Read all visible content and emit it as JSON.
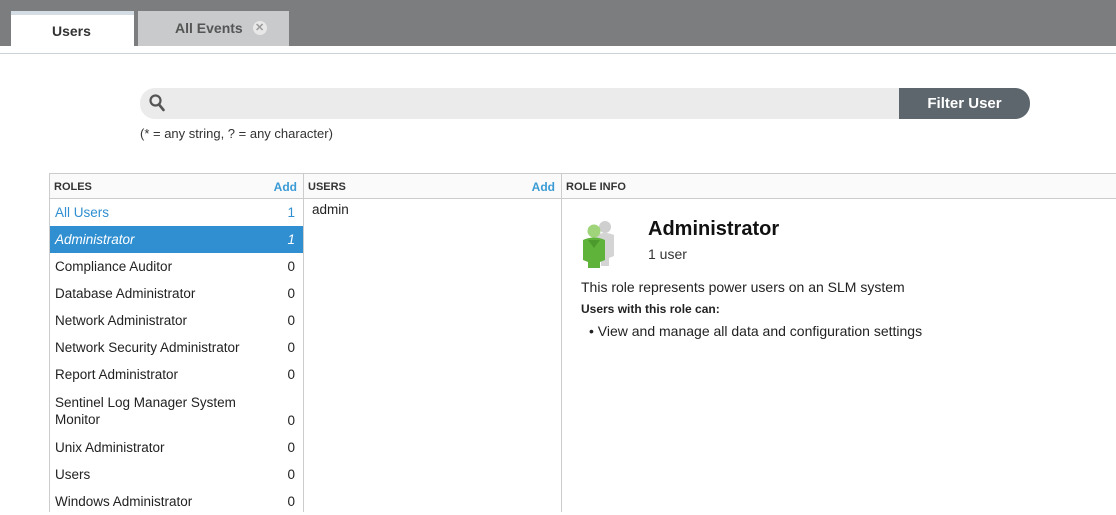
{
  "tabs": [
    {
      "label": "Users",
      "active": true
    },
    {
      "label": "All Events",
      "active": false,
      "close_icon": "close-icon"
    }
  ],
  "search": {
    "placeholder": "",
    "value": "",
    "button_label": "Filter User",
    "hint": "(* = any string, ? = any character)"
  },
  "roles_panel": {
    "header": "ROLES",
    "add_label": "Add",
    "items": [
      {
        "name": "All Users",
        "count": "1"
      },
      {
        "name": "Administrator",
        "count": "1"
      },
      {
        "name": "Compliance Auditor",
        "count": "0"
      },
      {
        "name": "Database Administrator",
        "count": "0"
      },
      {
        "name": "Network Administrator",
        "count": "0"
      },
      {
        "name": "Network Security Administrator",
        "count": "0"
      },
      {
        "name": "Report Administrator",
        "count": "0"
      },
      {
        "name": "Sentinel Log Manager System Monitor",
        "count": "0"
      },
      {
        "name": "Unix Administrator",
        "count": "0"
      },
      {
        "name": "Users",
        "count": "0"
      },
      {
        "name": "Windows Administrator",
        "count": "0"
      }
    ]
  },
  "users_panel": {
    "header": "USERS",
    "add_label": "Add",
    "items": [
      "admin"
    ]
  },
  "info_panel": {
    "header": "ROLE INFO",
    "role_name": "Administrator",
    "user_count": "1 user",
    "description": "This role represents power users on an SLM system",
    "can_label": "Users with this role can:",
    "permissions": [
      "• View and manage all data and configuration settings"
    ]
  },
  "colors": {
    "accent": "#2f8fd1",
    "tabbar": "#7b7d7f",
    "filter_button": "#5d666c",
    "role_icon_green": "#5fb23a"
  }
}
